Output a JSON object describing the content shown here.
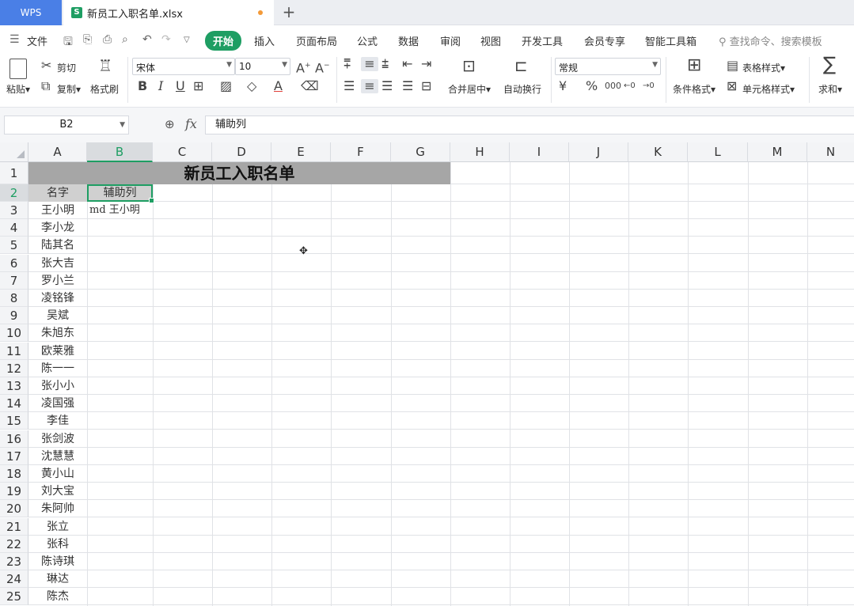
{
  "tabs": {
    "app": "WPS",
    "document": "新员工入职名单.xlsx",
    "add": "+"
  },
  "menu": {
    "file": "文件",
    "items": [
      "开始",
      "插入",
      "页面布局",
      "公式",
      "数据",
      "审阅",
      "视图",
      "开发工具",
      "会员专享",
      "智能工具箱"
    ],
    "search": "查找命令、搜索模板"
  },
  "ribbon": {
    "paste": "粘贴",
    "cut": "剪切",
    "copy": "复制",
    "format_painter": "格式刷",
    "font_name": "宋体",
    "font_size": "10",
    "merge_center": "合并居中",
    "wrap_text": "自动换行",
    "number_format": "常规",
    "conditional_format": "条件格式",
    "table_style": "表格样式",
    "cell_style": "单元格样式",
    "sum": "求和"
  },
  "formula_bar": {
    "name_box": "B2",
    "fx": "fx",
    "content": "辅助列"
  },
  "sheet": {
    "columns": [
      "A",
      "B",
      "C",
      "D",
      "E",
      "F",
      "G",
      "H",
      "I",
      "J",
      "K",
      "L",
      "M",
      "N"
    ],
    "rows": [
      "1",
      "2",
      "3",
      "4",
      "5",
      "6",
      "7",
      "8",
      "9",
      "10",
      "11",
      "12",
      "13",
      "14",
      "15",
      "16",
      "17",
      "18",
      "19",
      "20",
      "21",
      "22",
      "23",
      "24",
      "25"
    ],
    "title": "新员工入职名单",
    "header_a": "名字",
    "header_b": "辅助列",
    "b3": "md 王小明",
    "names": [
      "王小明",
      "李小龙",
      "陆其名",
      "张大吉",
      "罗小兰",
      "凌铭锋",
      "吴斌",
      "朱旭东",
      "欧莱雅",
      "陈一一",
      "张小小",
      "凌国强",
      "李佳",
      "张剑波",
      "沈慧慧",
      "黄小山",
      "刘大宝",
      "朱阿帅",
      "张立",
      "张科",
      "陈诗琪",
      "琳达",
      "陈杰"
    ]
  }
}
